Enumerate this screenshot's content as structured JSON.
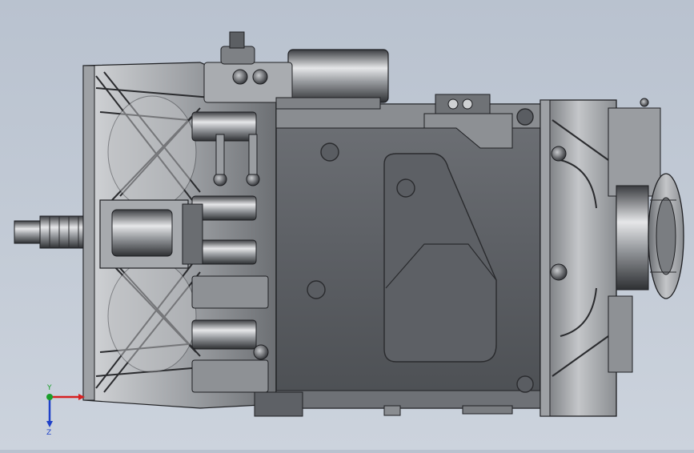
{
  "viewport": {
    "model": "gearbox-transmission-assembly",
    "view_orientation": "side"
  },
  "triad": {
    "y_label": "Y",
    "z_label": "Z",
    "x_label": "",
    "colors": {
      "x": "#d62020",
      "y": "#1a9e2a",
      "z": "#1e40c8"
    }
  },
  "colors": {
    "background": "#c1c9d4",
    "housing_dark": "#5a5d61",
    "housing_mid": "#7a7d82",
    "housing_light": "#b5b8bc",
    "edge": "#1e1f22"
  }
}
